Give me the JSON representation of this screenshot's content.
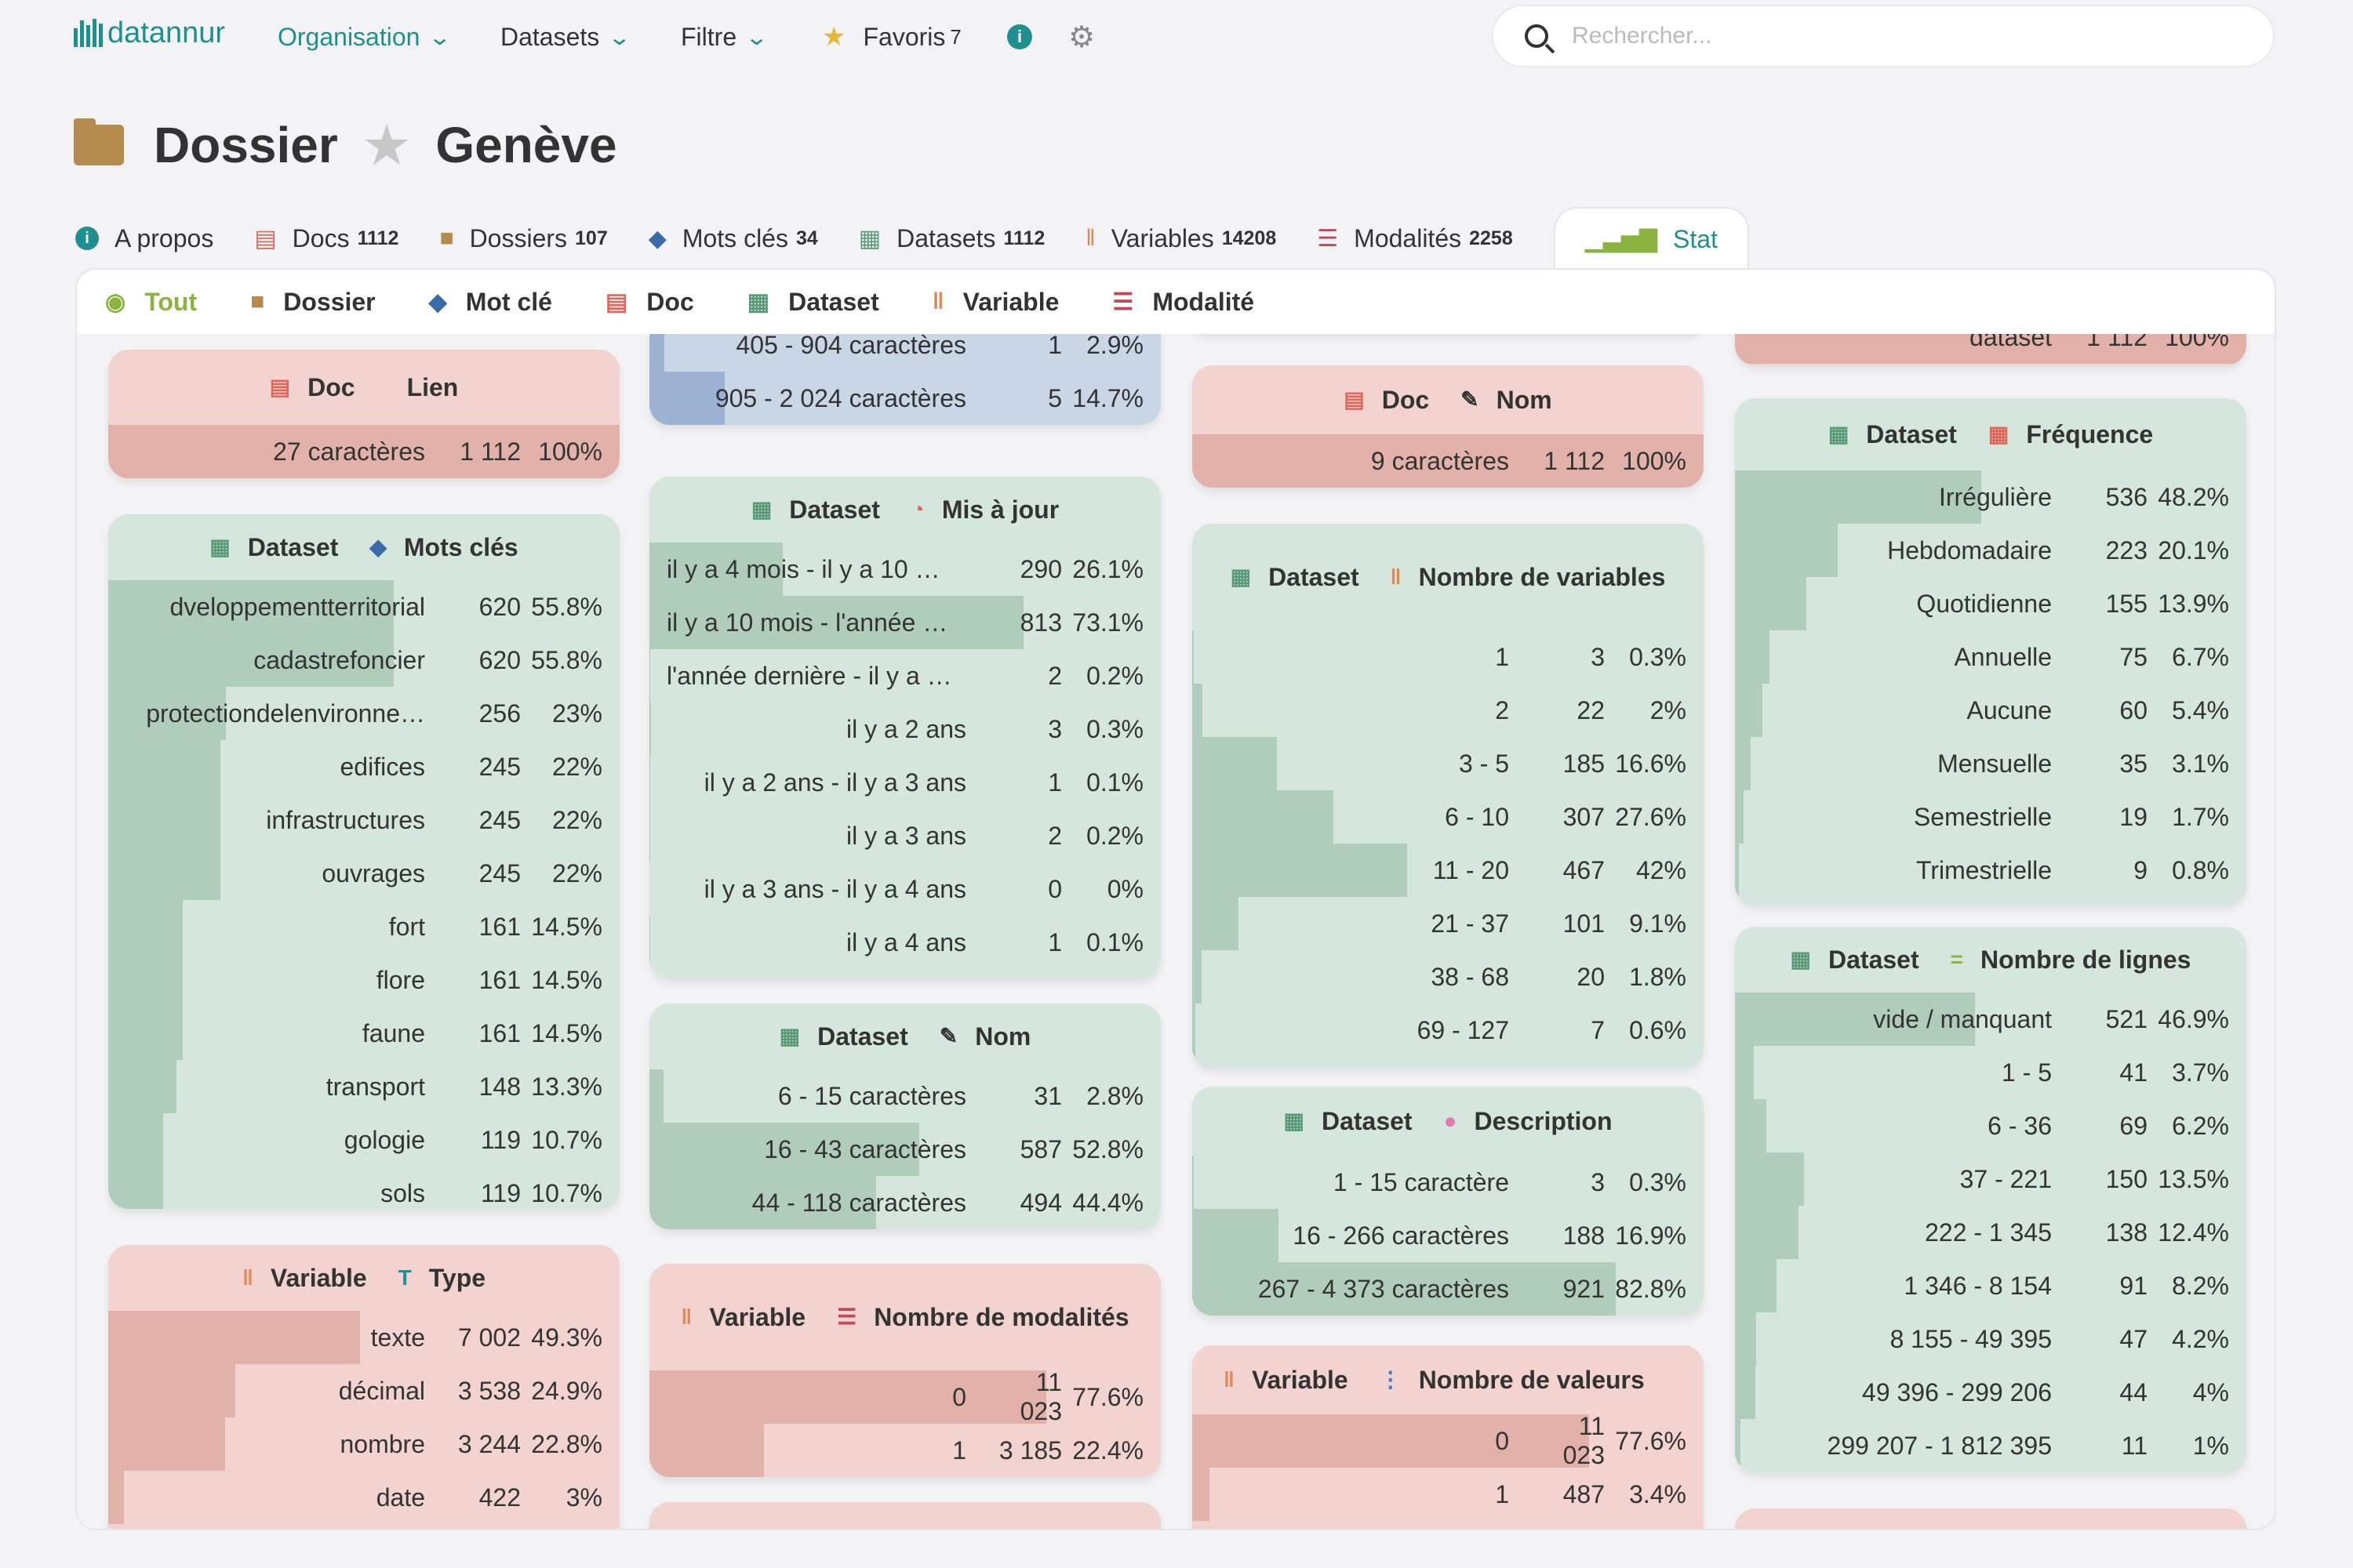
{
  "app": {
    "logo_text": "datannur"
  },
  "nav": {
    "organisation": "Organisation",
    "datasets": "Datasets",
    "filtre": "Filtre",
    "favoris": "Favoris",
    "favoris_count": "7"
  },
  "search": {
    "placeholder": "Rechercher..."
  },
  "page": {
    "type_label": "Dossier",
    "title": "Genève"
  },
  "tabs": [
    {
      "label": "A propos",
      "count": ""
    },
    {
      "label": "Docs",
      "count": "1112"
    },
    {
      "label": "Dossiers",
      "count": "107"
    },
    {
      "label": "Mots clés",
      "count": "34"
    },
    {
      "label": "Datasets",
      "count": "1112"
    },
    {
      "label": "Variables",
      "count": "14208"
    },
    {
      "label": "Modalités",
      "count": "2258"
    },
    {
      "label": "Stat",
      "count": ""
    }
  ],
  "subtabs": [
    "Tout",
    "Dossier",
    "Mot clé",
    "Doc",
    "Dataset",
    "Variable",
    "Modalité"
  ],
  "cards": {
    "c1_doc_lien": {
      "entity": "Doc",
      "attr": "Lien",
      "rows": [
        {
          "label": "27 caractères",
          "n": "1 112",
          "p": "100%",
          "f": 1.0
        }
      ]
    },
    "c1_ds_motscles": {
      "entity": "Dataset",
      "attr": "Mots clés",
      "rows": [
        {
          "label": "dveloppementterritorial",
          "n": "620",
          "p": "55.8%",
          "f": 0.558
        },
        {
          "label": "cadastrefoncier",
          "n": "620",
          "p": "55.8%",
          "f": 0.558
        },
        {
          "label": "protectiondelenvironne…",
          "n": "256",
          "p": "23%",
          "f": 0.23
        },
        {
          "label": "edifices",
          "n": "245",
          "p": "22%",
          "f": 0.22
        },
        {
          "label": "infrastructures",
          "n": "245",
          "p": "22%",
          "f": 0.22
        },
        {
          "label": "ouvrages",
          "n": "245",
          "p": "22%",
          "f": 0.22
        },
        {
          "label": "fort",
          "n": "161",
          "p": "14.5%",
          "f": 0.145
        },
        {
          "label": "flore",
          "n": "161",
          "p": "14.5%",
          "f": 0.145
        },
        {
          "label": "faune",
          "n": "161",
          "p": "14.5%",
          "f": 0.145
        },
        {
          "label": "transport",
          "n": "148",
          "p": "13.3%",
          "f": 0.133
        },
        {
          "label": "gologie",
          "n": "119",
          "p": "10.7%",
          "f": 0.107
        },
        {
          "label": "sols",
          "n": "119",
          "p": "10.7%",
          "f": 0.107
        }
      ]
    },
    "c1_var_type": {
      "entity": "Variable",
      "attr": "Type",
      "rows": [
        {
          "label": "texte",
          "n": "7 002",
          "p": "49.3%",
          "f": 0.493
        },
        {
          "label": "décimal",
          "n": "3 538",
          "p": "24.9%",
          "f": 0.249
        },
        {
          "label": "nombre",
          "n": "3 244",
          "p": "22.8%",
          "f": 0.228
        },
        {
          "label": "date",
          "n": "422",
          "p": "3%",
          "f": 0.03
        }
      ]
    },
    "c2_doc_desc": {
      "rows": [
        {
          "label": "405 - 904 caractères",
          "n": "1",
          "p": "2.9%",
          "f": 0.029
        },
        {
          "label": "905 - 2 024 caractères",
          "n": "5",
          "p": "14.7%",
          "f": 0.147
        }
      ]
    },
    "c2_ds_maj": {
      "entity": "Dataset",
      "attr": "Mis à jour",
      "rows": [
        {
          "label": "il y a 4 mois - il y a 10 …",
          "n": "290",
          "p": "26.1%",
          "f": 0.261
        },
        {
          "label": "il y a 10 mois - l'année …",
          "n": "813",
          "p": "73.1%",
          "f": 0.731
        },
        {
          "label": "l'année dernière - il y a …",
          "n": "2",
          "p": "0.2%",
          "f": 0.002
        },
        {
          "label": "il y a 2 ans",
          "n": "3",
          "p": "0.3%",
          "f": 0.003
        },
        {
          "label": "il y a 2 ans - il y a 3 ans",
          "n": "1",
          "p": "0.1%",
          "f": 0.001
        },
        {
          "label": "il y a 3 ans",
          "n": "2",
          "p": "0.2%",
          "f": 0.002
        },
        {
          "label": "il y a 3 ans - il y a 4 ans",
          "n": "0",
          "p": "0%",
          "f": 0.0
        },
        {
          "label": "il y a 4 ans",
          "n": "1",
          "p": "0.1%",
          "f": 0.001
        }
      ]
    },
    "c2_ds_nom": {
      "entity": "Dataset",
      "attr": "Nom",
      "rows": [
        {
          "label": "6 - 15 caractères",
          "n": "31",
          "p": "2.8%",
          "f": 0.028
        },
        {
          "label": "16 - 43 caractères",
          "n": "587",
          "p": "52.8%",
          "f": 0.528
        },
        {
          "label": "44 - 118 caractères",
          "n": "494",
          "p": "44.4%",
          "f": 0.444
        }
      ]
    },
    "c2_var_nbmod": {
      "entity": "Variable",
      "attr": "Nombre de modalités",
      "rows": [
        {
          "label": "0",
          "n": "11 023",
          "p": "77.6%",
          "f": 0.776
        },
        {
          "label": "1",
          "n": "3 185",
          "p": "22.4%",
          "f": 0.224
        }
      ]
    },
    "c3_doc_nom": {
      "entity": "Doc",
      "attr": "Nom",
      "rows": [
        {
          "label": "9 caractères",
          "n": "1 112",
          "p": "100%",
          "f": 1.0
        }
      ]
    },
    "c3_ds_nbvar": {
      "entity": "Dataset",
      "attr": "Nombre de variables",
      "rows": [
        {
          "label": "1",
          "n": "3",
          "p": "0.3%",
          "f": 0.003
        },
        {
          "label": "2",
          "n": "22",
          "p": "2%",
          "f": 0.02
        },
        {
          "label": "3 - 5",
          "n": "185",
          "p": "16.6%",
          "f": 0.166
        },
        {
          "label": "6 - 10",
          "n": "307",
          "p": "27.6%",
          "f": 0.276
        },
        {
          "label": "11 - 20",
          "n": "467",
          "p": "42%",
          "f": 0.42
        },
        {
          "label": "21 - 37",
          "n": "101",
          "p": "9.1%",
          "f": 0.091
        },
        {
          "label": "38 - 68",
          "n": "20",
          "p": "1.8%",
          "f": 0.018
        },
        {
          "label": "69 - 127",
          "n": "7",
          "p": "0.6%",
          "f": 0.006
        }
      ]
    },
    "c3_ds_desc": {
      "entity": "Dataset",
      "attr": "Description",
      "rows": [
        {
          "label": "1 - 15 caractère",
          "n": "3",
          "p": "0.3%",
          "f": 0.003
        },
        {
          "label": "16 - 266 caractères",
          "n": "188",
          "p": "16.9%",
          "f": 0.169
        },
        {
          "label": "267 - 4 373 caractères",
          "n": "921",
          "p": "82.8%",
          "f": 0.828
        }
      ]
    },
    "c3_var_nbval": {
      "entity": "Variable",
      "attr": "Nombre de valeurs",
      "rows": [
        {
          "label": "0",
          "n": "11 023",
          "p": "77.6%",
          "f": 0.776
        },
        {
          "label": "1",
          "n": "487",
          "p": "3.4%",
          "f": 0.034
        }
      ]
    },
    "c4_top": {
      "rows": [
        {
          "label": "dataset",
          "n": "1 112",
          "p": "100%",
          "f": 1.0
        }
      ]
    },
    "c4_ds_freq": {
      "entity": "Dataset",
      "attr": "Fréquence",
      "rows": [
        {
          "label": "Irrégulière",
          "n": "536",
          "p": "48.2%",
          "f": 0.482
        },
        {
          "label": "Hebdomadaire",
          "n": "223",
          "p": "20.1%",
          "f": 0.201
        },
        {
          "label": "Quotidienne",
          "n": "155",
          "p": "13.9%",
          "f": 0.139
        },
        {
          "label": "Annuelle",
          "n": "75",
          "p": "6.7%",
          "f": 0.067
        },
        {
          "label": "Aucune",
          "n": "60",
          "p": "5.4%",
          "f": 0.054
        },
        {
          "label": "Mensuelle",
          "n": "35",
          "p": "3.1%",
          "f": 0.031
        },
        {
          "label": "Semestrielle",
          "n": "19",
          "p": "1.7%",
          "f": 0.017
        },
        {
          "label": "Trimestrielle",
          "n": "9",
          "p": "0.8%",
          "f": 0.008
        }
      ]
    },
    "c4_ds_nblignes": {
      "entity": "Dataset",
      "attr": "Nombre de lignes",
      "rows": [
        {
          "label": "vide / manquant",
          "n": "521",
          "p": "46.9%",
          "f": 0.469
        },
        {
          "label": "1 - 5",
          "n": "41",
          "p": "3.7%",
          "f": 0.037
        },
        {
          "label": "6 - 36",
          "n": "69",
          "p": "6.2%",
          "f": 0.062
        },
        {
          "label": "37 - 221",
          "n": "150",
          "p": "13.5%",
          "f": 0.135
        },
        {
          "label": "222 - 1 345",
          "n": "138",
          "p": "12.4%",
          "f": 0.124
        },
        {
          "label": "1 346 - 8 154",
          "n": "91",
          "p": "8.2%",
          "f": 0.082
        },
        {
          "label": "8 155 - 49 395",
          "n": "47",
          "p": "4.2%",
          "f": 0.042
        },
        {
          "label": "49 396 - 299 206",
          "n": "44",
          "p": "4%",
          "f": 0.04
        },
        {
          "label": "299 207 - 1 812 395",
          "n": "11",
          "p": "1%",
          "f": 0.01
        }
      ]
    }
  }
}
